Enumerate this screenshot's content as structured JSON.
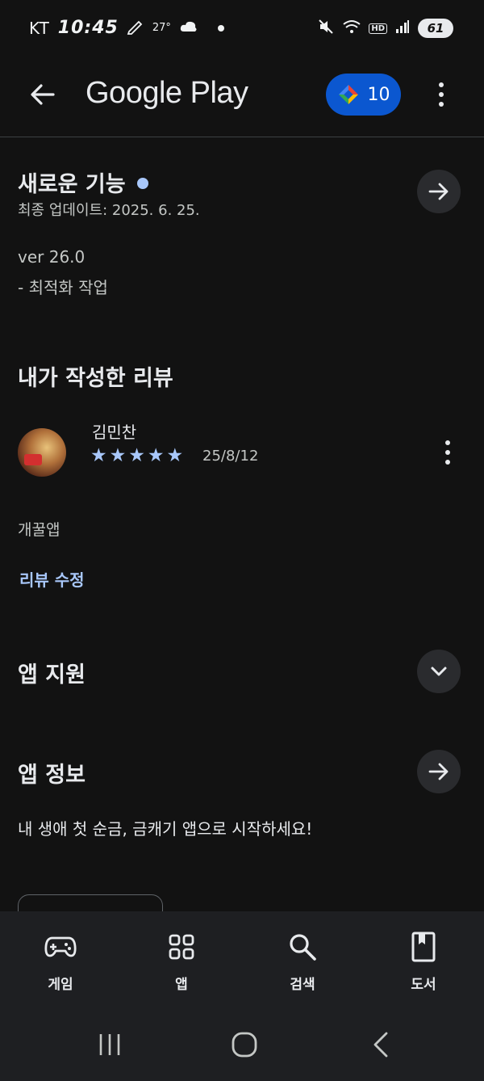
{
  "status_bar": {
    "carrier": "KT",
    "time": "10:45",
    "temperature": "27°",
    "battery": "61",
    "hd_label": "HD"
  },
  "app_bar": {
    "title": "Google Play",
    "points": "10",
    "back_icon": "arrow-left-icon",
    "more_icon": "more-vert-icon"
  },
  "whats_new": {
    "title": "새로운 기능",
    "last_updated": "최종 업데이트: 2025. 6. 25.",
    "version": "ver 26.0",
    "notes": "- 최적화 작업"
  },
  "my_review": {
    "title": "내가 작성한 리뷰",
    "reviewer_name": "김민찬",
    "rating": 5,
    "date": "25/8/12",
    "text": "개꿀앱",
    "edit_label": "리뷰 수정"
  },
  "app_support": {
    "title": "앱 지원"
  },
  "app_info": {
    "title": "앱 정보",
    "description": "내 생애 첫 순금, 금캐기 앱으로 시작하세요!"
  },
  "bottom_nav": [
    {
      "label": "게임",
      "icon": "gamepad-icon"
    },
    {
      "label": "앱",
      "icon": "apps-grid-icon"
    },
    {
      "label": "검색",
      "icon": "search-icon"
    },
    {
      "label": "도서",
      "icon": "book-icon"
    }
  ],
  "colors": {
    "background": "#121212",
    "accent": "#a8c7fa",
    "points_pill": "#0b57d0",
    "nav_bg": "#1e1f22"
  }
}
